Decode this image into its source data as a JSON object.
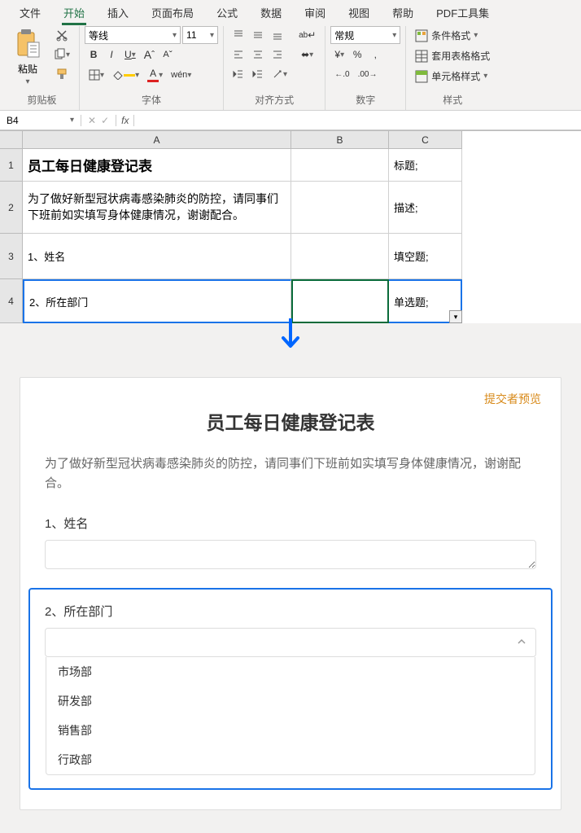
{
  "ribbon": {
    "tabs": [
      "文件",
      "开始",
      "插入",
      "页面布局",
      "公式",
      "数据",
      "审阅",
      "视图",
      "帮助",
      "PDF工具集"
    ],
    "active_tab_index": 1,
    "groups": {
      "clipboard": {
        "label": "剪贴板",
        "paste": "粘贴"
      },
      "font": {
        "label": "字体",
        "family": "等线",
        "size": "11",
        "bold": "B",
        "italic": "I",
        "underline": "U",
        "increase": "A",
        "decrease": "A",
        "border": "⊞",
        "fill": "◇",
        "color": "A",
        "phonetic": "wén"
      },
      "align": {
        "label": "对齐方式",
        "wrap": "ab",
        "merge": "⬌"
      },
      "number": {
        "label": "数字",
        "format": "常规",
        "currency": "¥",
        "percent": "%",
        "comma": ",",
        "inc": "←.0",
        "dec": ".00→"
      },
      "styles": {
        "label": "样式",
        "cond": "条件格式",
        "table": "套用表格格式",
        "cell": "单元格样式"
      }
    }
  },
  "formula_bar": {
    "name_box": "B4",
    "cancel": "✕",
    "confirm": "✓",
    "fx": "fx",
    "value": ""
  },
  "sheet": {
    "columns": [
      "A",
      "B",
      "C"
    ],
    "rows": [
      {
        "num": "1",
        "a_class": "title-text",
        "a": "员工每日健康登记表",
        "b": "",
        "c": "标题;"
      },
      {
        "num": "2",
        "a_class": "desc-text",
        "a": "为了做好新型冠状病毒感染肺炎的防控，请同事们下班前如实填写身体健康情况，谢谢配合。",
        "b": "",
        "c": "描述;"
      },
      {
        "num": "3",
        "a": "1、姓名",
        "b": "",
        "c": "填空题;"
      },
      {
        "num": "4",
        "a": "2、所在部门",
        "b": "",
        "c": "单选题;"
      }
    ]
  },
  "preview": {
    "link": "提交者预览",
    "title": "员工每日健康登记表",
    "desc": "为了做好新型冠状病毒感染肺炎的防控，请同事们下班前如实填写身体健康情况，谢谢配合。",
    "q1_label": "1、姓名",
    "q2_label": "2、所在部门",
    "options": [
      "市场部",
      "研发部",
      "销售部",
      "行政部"
    ]
  }
}
